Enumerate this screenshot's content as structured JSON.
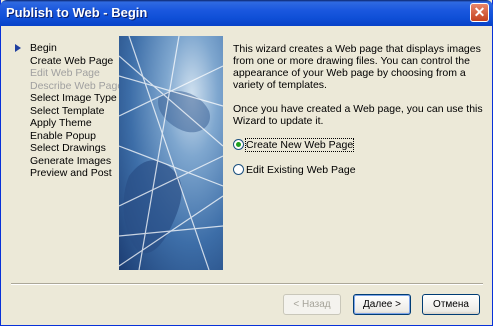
{
  "window": {
    "title": "Publish to Web - Begin"
  },
  "steps": [
    {
      "label": "Begin",
      "state": "current"
    },
    {
      "label": "Create Web Page",
      "state": "normal"
    },
    {
      "label": "Edit Web Page",
      "state": "disabled"
    },
    {
      "label": "Describe Web Page",
      "state": "disabled"
    },
    {
      "label": "Select Image Type",
      "state": "normal"
    },
    {
      "label": "Select Template",
      "state": "normal"
    },
    {
      "label": "Apply Theme",
      "state": "normal"
    },
    {
      "label": "Enable Popup",
      "state": "normal"
    },
    {
      "label": "Select Drawings",
      "state": "normal"
    },
    {
      "label": "Generate Images",
      "state": "normal"
    },
    {
      "label": "Preview and Post",
      "state": "normal"
    }
  ],
  "content": {
    "intro": "This wizard creates a Web page that displays images from one or more drawing files. You can control the appearance of your Web page by choosing from a variety of templates.",
    "update_note": "Once you have created a Web page, you can use this Wizard to update it.",
    "options": [
      {
        "label": "Create New Web Page",
        "checked": true
      },
      {
        "label": "Edit Existing Web Page",
        "checked": false
      }
    ]
  },
  "buttons": {
    "back": "< Назад",
    "next": "Далее >",
    "cancel": "Отмена"
  }
}
